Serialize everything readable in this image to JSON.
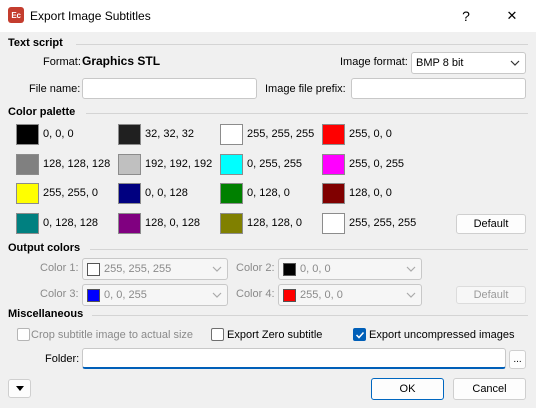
{
  "window": {
    "title": "Export Image Subtitles",
    "help_label": "?",
    "close_label": "✕",
    "app_icon_text": "Ec"
  },
  "text_script": {
    "heading": "Text script",
    "format_label": "Format:",
    "format_value": "Graphics STL",
    "image_format_label": "Image format:",
    "image_format_value": "BMP 8 bit",
    "file_name_label": "File name:",
    "file_name_value": "",
    "prefix_label": "Image file prefix:",
    "prefix_value": ""
  },
  "palette": {
    "heading": "Color palette",
    "colors": [
      {
        "value": "0, 0, 0",
        "hex": "#000000"
      },
      {
        "value": "32, 32, 32",
        "hex": "#202020"
      },
      {
        "value": "255, 255, 255",
        "hex": "#ffffff"
      },
      {
        "value": "255, 0, 0",
        "hex": "#ff0000"
      },
      {
        "value": "128, 128, 128",
        "hex": "#808080"
      },
      {
        "value": "192, 192, 192",
        "hex": "#c0c0c0"
      },
      {
        "value": "0, 255, 255",
        "hex": "#00ffff"
      },
      {
        "value": "255, 0, 255",
        "hex": "#ff00ff"
      },
      {
        "value": "255, 255, 0",
        "hex": "#ffff00"
      },
      {
        "value": "0, 0, 128",
        "hex": "#000080"
      },
      {
        "value": "0, 128, 0",
        "hex": "#008000"
      },
      {
        "value": "128, 0, 0",
        "hex": "#800000"
      },
      {
        "value": "0, 128, 128",
        "hex": "#008080"
      },
      {
        "value": "128, 0, 128",
        "hex": "#800080"
      },
      {
        "value": "128, 128, 0",
        "hex": "#808000"
      },
      {
        "value": "255, 255, 255",
        "hex": "#ffffff"
      }
    ],
    "default_label": "Default"
  },
  "output_colors": {
    "heading": "Output colors",
    "color1_label": "Color 1:",
    "color1_value": "255, 255, 255",
    "color1_hex": "#ffffff",
    "color2_label": "Color 2:",
    "color2_value": "0, 0, 0",
    "color2_hex": "#000000",
    "color3_label": "Color 3:",
    "color3_value": "0, 0, 255",
    "color3_hex": "#0000ff",
    "color4_label": "Color 4:",
    "color4_value": "255, 0, 0",
    "color4_hex": "#ff0000",
    "default_label": "Default"
  },
  "misc": {
    "heading": "Miscellaneous",
    "crop_label": "Crop subtitle image to actual size",
    "crop_checked": false,
    "zero_label": "Export Zero subtitle",
    "zero_checked": false,
    "uncompressed_label": "Export uncompressed images",
    "uncompressed_checked": true,
    "folder_label": "Folder:",
    "folder_value": "",
    "browse_label": "..."
  },
  "footer": {
    "ok_label": "OK",
    "cancel_label": "Cancel"
  },
  "colors": {
    "accent": "#005fb8",
    "app_icon": "#c43d2e"
  }
}
